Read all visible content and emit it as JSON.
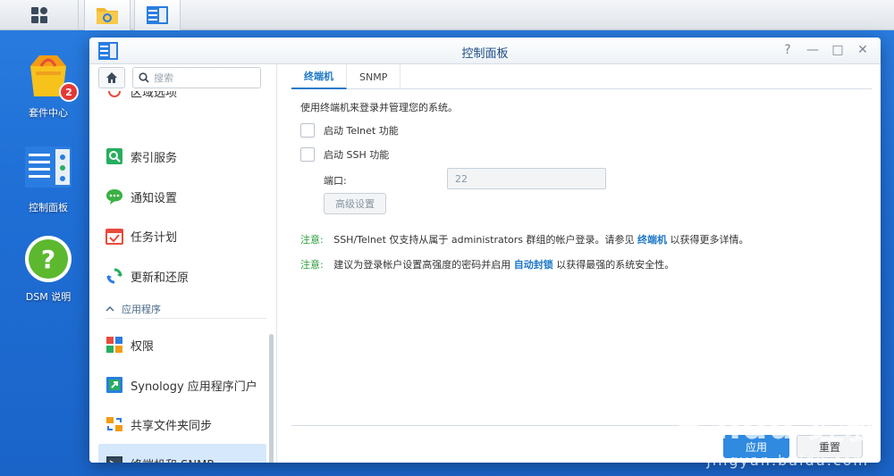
{
  "taskbar": {
    "main_icon": "main-menu-icon",
    "apps": [
      {
        "icon": "file-station-icon"
      },
      {
        "icon": "control-panel-icon"
      }
    ]
  },
  "desktop": {
    "icons": [
      {
        "label": "套件中心",
        "icon": "package-center-icon",
        "badge": "2"
      },
      {
        "label": "控制面板",
        "icon": "control-panel-icon"
      },
      {
        "label": "DSM 说明",
        "icon": "help-icon"
      }
    ]
  },
  "window": {
    "title": "控制面板",
    "controls": [
      "?",
      "—",
      "□",
      "✕"
    ]
  },
  "sidebar": {
    "search_placeholder": "搜索",
    "partial_item": "区域选项",
    "items": [
      {
        "label": "索引服务",
        "icon": "index-service-icon"
      },
      {
        "label": "通知设置",
        "icon": "notification-icon"
      },
      {
        "label": "任务计划",
        "icon": "task-scheduler-icon"
      },
      {
        "label": "更新和还原",
        "icon": "update-restore-icon"
      }
    ],
    "section": "应用程序",
    "app_items": [
      {
        "label": "权限",
        "icon": "privileges-icon"
      },
      {
        "label": "Synology 应用程序门户",
        "icon": "app-portal-icon"
      },
      {
        "label": "共享文件夹同步",
        "icon": "shared-folder-sync-icon"
      },
      {
        "label": "终端机和 SNMP",
        "icon": "terminal-snmp-icon",
        "active": true
      }
    ]
  },
  "main": {
    "tabs": [
      {
        "label": "终端机",
        "active": true
      },
      {
        "label": "SNMP",
        "active": false
      }
    ],
    "description": "使用终端机来登录并管理您的系统。",
    "telnet_label": "启动 Telnet 功能",
    "ssh_label": "启动 SSH 功能",
    "port_label": "端口:",
    "port_value": "22",
    "advanced_button": "高级设置",
    "note1": {
      "label": "注意:",
      "text_before": "SSH/Telnet 仅支持从属于 administrators 群组的帐户登录。请参见",
      "link": "终端机",
      "text_after": "以获得更多详情。"
    },
    "note2": {
      "label": "注意:",
      "text_before": "建议为登录帐户设置高强度的密码并启用",
      "link": "自动封锁",
      "text_after": "以获得最强的系统安全性。"
    }
  },
  "footer": {
    "apply_label": "应用",
    "reset_label": "重置"
  },
  "watermark": {
    "text": "Baidu 经验",
    "sub": "jingyan.baidu.com"
  },
  "colors": {
    "accent": "#1e78c8",
    "desktop": "#1f6fd6",
    "note_label": "#2a9d3a"
  }
}
